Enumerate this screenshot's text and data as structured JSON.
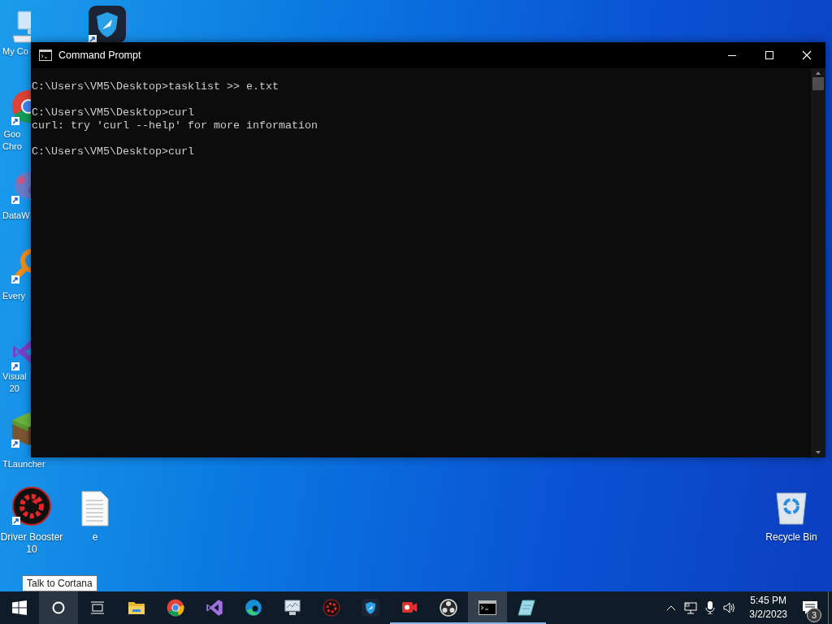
{
  "desktop_icons": [
    {
      "kind": "computer",
      "label": "My Co"
    },
    {
      "kind": "shield-app"
    },
    {
      "kind": "chrome",
      "label": "Goo\nChro"
    },
    {
      "kind": "dots",
      "label": "DataW"
    },
    {
      "kind": "orange-app",
      "label": "Every"
    },
    {
      "kind": "vs",
      "label": "Visual\n20"
    },
    {
      "kind": "grass",
      "label": "TLauncher"
    },
    {
      "kind": "booster",
      "label": "Driver Booster\n10"
    },
    {
      "kind": "document",
      "label": "e"
    },
    {
      "kind": "recycle",
      "label": "Recycle Bin"
    }
  ],
  "window": {
    "title": "Command Prompt",
    "console": [
      [
        "C:\\Users\\VM5\\Desktop>tasklist >> e.txt"
      ],
      [
        "C:\\Users\\VM5\\Desktop>curl",
        "curl: try 'curl --help' for more information"
      ],
      [
        "C:\\Users\\VM5\\Desktop>curl"
      ]
    ]
  },
  "tooltip": "Talk to Cortana",
  "taskbar": {
    "items": [
      {
        "kind": "start",
        "hovered": false,
        "running": false,
        "active": false
      },
      {
        "kind": "cortana",
        "hovered": true,
        "running": false,
        "active": false
      },
      {
        "kind": "taskview",
        "hovered": false,
        "running": false,
        "active": false
      },
      {
        "kind": "explorer",
        "hovered": false,
        "running": false,
        "active": false
      },
      {
        "kind": "chrome",
        "hovered": false,
        "running": false,
        "active": false
      },
      {
        "kind": "vs",
        "hovered": false,
        "running": false,
        "active": false
      },
      {
        "kind": "edge",
        "hovered": false,
        "running": false,
        "active": false
      },
      {
        "kind": "monitor",
        "hovered": false,
        "running": false,
        "active": false
      },
      {
        "kind": "booster",
        "hovered": false,
        "running": false,
        "active": false
      },
      {
        "kind": "shield-app",
        "hovered": false,
        "running": false,
        "active": false
      },
      {
        "kind": "recorder",
        "hovered": false,
        "running": true,
        "active": false
      },
      {
        "kind": "obs",
        "hovered": false,
        "running": true,
        "active": false
      },
      {
        "kind": "cmd",
        "hovered": false,
        "running": true,
        "active": true
      },
      {
        "kind": "notepad",
        "hovered": false,
        "running": true,
        "active": false
      }
    ],
    "time": "5:45 PM",
    "date": "3/2/2023",
    "notifications": "3"
  }
}
